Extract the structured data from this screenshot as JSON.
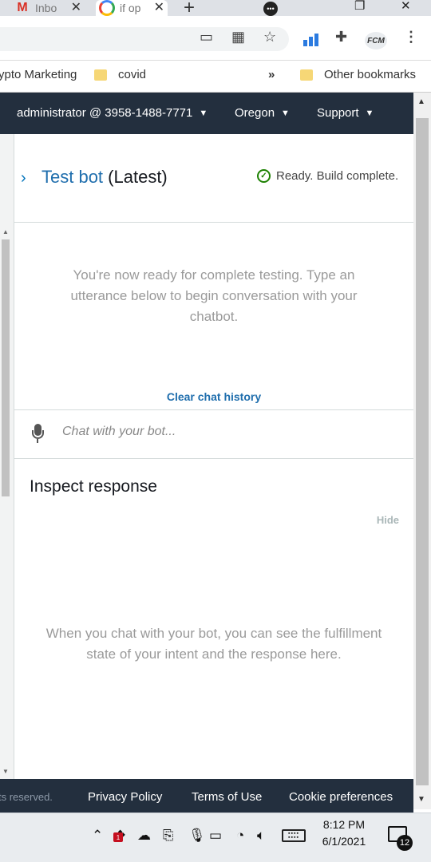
{
  "browser": {
    "tabs": [
      {
        "label": "Inbo",
        "icon": "gmail-icon"
      },
      {
        "label": "if op",
        "icon": "google-icon"
      }
    ],
    "new_tab": "+",
    "window_buttons": {
      "minimize": "⬤",
      "restore": "❐",
      "close": "✕"
    },
    "extension_avatar": "FCM"
  },
  "bookmarks": {
    "items": [
      {
        "label": "ypto Marketing"
      },
      {
        "label": "covid"
      }
    ],
    "overflow": "»",
    "other": "Other bookmarks"
  },
  "aws_header": {
    "account": "administrator @ 3958-1488-7771",
    "region": "Oregon",
    "support": "Support"
  },
  "test_bot": {
    "title_link": "Test bot",
    "title_suffix": "(Latest)",
    "status": "Ready. Build complete.",
    "ready_message": "You're now ready for complete testing. Type an utterance below to begin conversation with your chatbot.",
    "clear_history": "Clear chat history",
    "chat_placeholder": "Chat with your bot...",
    "inspect_title": "Inspect response",
    "hide_label": "Hide",
    "inspect_message": "When you chat with your bot, you can see the fulfillment state of your intent and the response here."
  },
  "footer": {
    "rights": "ts reserved.",
    "privacy": "Privacy Policy",
    "terms": "Terms of Use",
    "cookies": "Cookie preferences"
  },
  "taskbar": {
    "time": "8:12 PM",
    "date": "6/1/2021",
    "notifications_count": "12",
    "badge": "1"
  },
  "colors": {
    "aws_navy": "#232f3e",
    "link_blue": "#1f6ead",
    "success_green": "#1d8102",
    "muted_text": "#9a9a9a"
  }
}
